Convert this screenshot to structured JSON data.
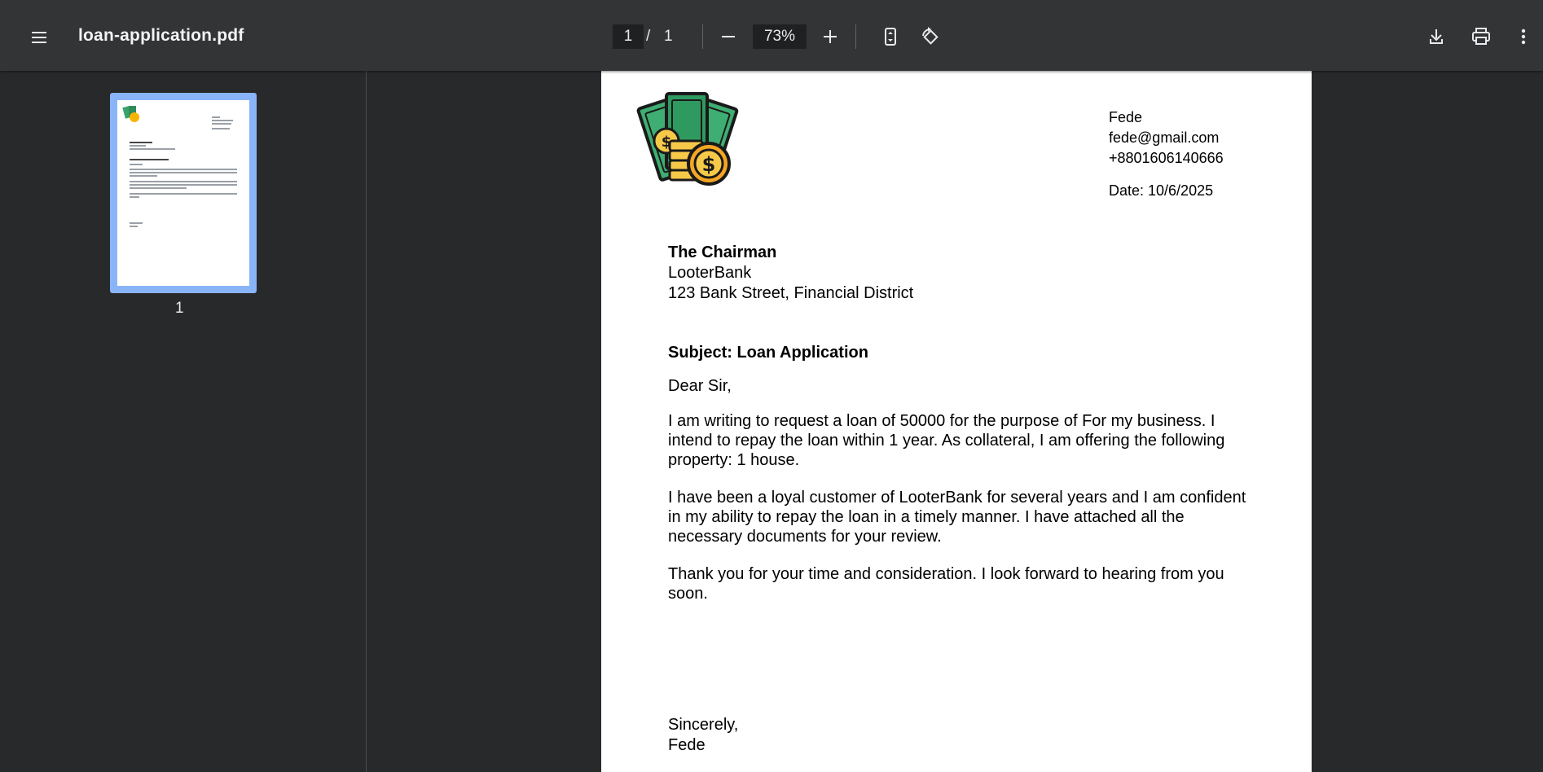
{
  "toolbar": {
    "title": "loan-application.pdf",
    "page_current": "1",
    "page_separator": "/",
    "page_total": "1",
    "zoom": "73%",
    "icons": [
      "menu-icon",
      "zoom-out-icon",
      "zoom-in-icon",
      "fit-page-icon",
      "rotate-icon",
      "download-icon",
      "print-icon",
      "more-vert-icon"
    ]
  },
  "sidebar": {
    "thumbnails": [
      {
        "label": "1",
        "selected": true
      }
    ],
    "accent": "#8ab4f8"
  },
  "document": {
    "sender": {
      "name": "Fede",
      "email": "fede@gmail.com",
      "phone": "+8801606140666",
      "date": "Date: 10/6/2025"
    },
    "recipient": {
      "title": "The Chairman",
      "org": "LooterBank",
      "address": "123 Bank Street, Financial District"
    },
    "subject": "Subject: Loan Application",
    "salutation": "Dear Sir,",
    "paragraphs": [
      "I am writing to request a loan of 50000 for the purpose of For my business. I intend to repay the loan within 1 year. As collateral, I am offering the following property: 1 house.",
      "I have been a loyal customer of LooterBank for several years and I am confident in my ability to repay the loan in a timely manner. I have attached all the necessary documents for your review.",
      "Thank you for your time and consideration. I look forward to hearing from you soon."
    ],
    "closing": "Sincerely,",
    "signature": "Fede",
    "logo_icon": "money-coins-icon"
  }
}
